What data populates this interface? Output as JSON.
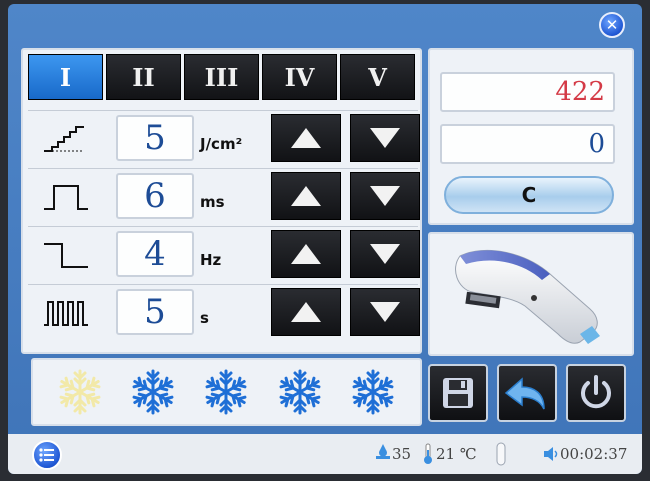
{
  "window": {
    "close_icon": "close-icon"
  },
  "tabs": [
    {
      "label": "I",
      "active": true
    },
    {
      "label": "II",
      "active": false
    },
    {
      "label": "III",
      "active": false
    },
    {
      "label": "IV",
      "active": false
    },
    {
      "label": "V",
      "active": false
    }
  ],
  "params": [
    {
      "icon": "energy-steps-icon",
      "value": "5",
      "unit": "J/cm²"
    },
    {
      "icon": "pulse-width-icon",
      "value": "6",
      "unit": "ms"
    },
    {
      "icon": "frequency-icon",
      "value": "4",
      "unit": "Hz"
    },
    {
      "icon": "pulse-train-icon",
      "value": "5",
      "unit": "s"
    }
  ],
  "counters": {
    "total": "422",
    "session": "0",
    "reset_label": "C"
  },
  "cooling": {
    "levels": 5,
    "icon": "snowflake-icon",
    "colors": [
      "#f2e9a8",
      "#1f6fd6",
      "#1f6fd6",
      "#1f6fd6",
      "#1f6fd6"
    ]
  },
  "buttons": {
    "save_icon": "save-icon",
    "back_icon": "back-icon",
    "power_icon": "power-icon"
  },
  "status": {
    "water_level": "35",
    "temperature": "21 ℃",
    "time": "00:02:37"
  },
  "colors": {
    "accent": "#1f6fd6",
    "counter_total": "#d43a46",
    "value_text": "#1d4c96"
  }
}
